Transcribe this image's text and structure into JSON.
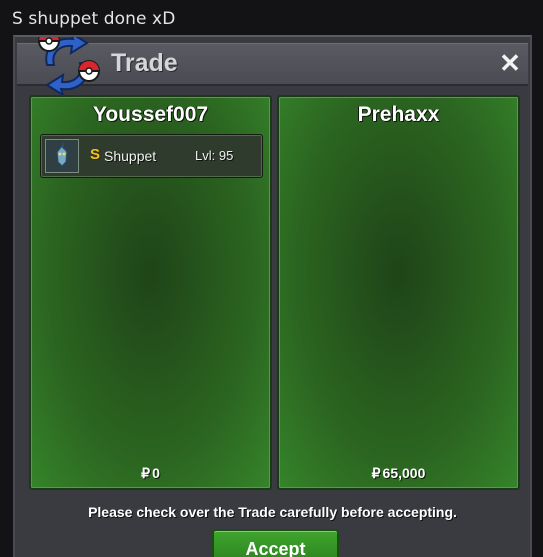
{
  "caption": "S shuppet done xD",
  "window": {
    "title": "Trade",
    "close_label": "✕"
  },
  "left_panel": {
    "player": "Youssef007",
    "items": [
      {
        "badge": "S",
        "name": "Shuppet",
        "level": "Lvl: 95",
        "icon": "shuppet-sprite-icon"
      }
    ],
    "money_symbol": "₽",
    "money": "0"
  },
  "right_panel": {
    "player": "Prehaxx",
    "items": [],
    "money_symbol": "₽",
    "money": "65,000"
  },
  "notice": "Please check over the Trade carefully before accepting.",
  "accept_button": {
    "label": "Accept"
  },
  "colors": {
    "panel_green": "#2b6420",
    "accept_green": "#3fa52e",
    "shiny_gold": "#f2c21a",
    "window_gray": "#3a3a41"
  }
}
